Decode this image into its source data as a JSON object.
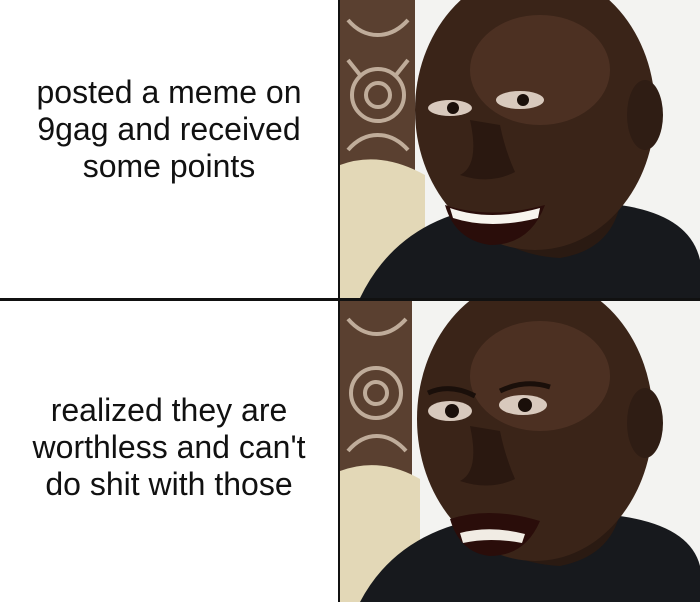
{
  "panels": [
    {
      "caption": "posted a meme on\n9gag and received\nsome points",
      "expression": "happy-smile"
    },
    {
      "caption": "realized they are\nworthless and can't\ndo shit with those",
      "expression": "disappointed"
    }
  ]
}
